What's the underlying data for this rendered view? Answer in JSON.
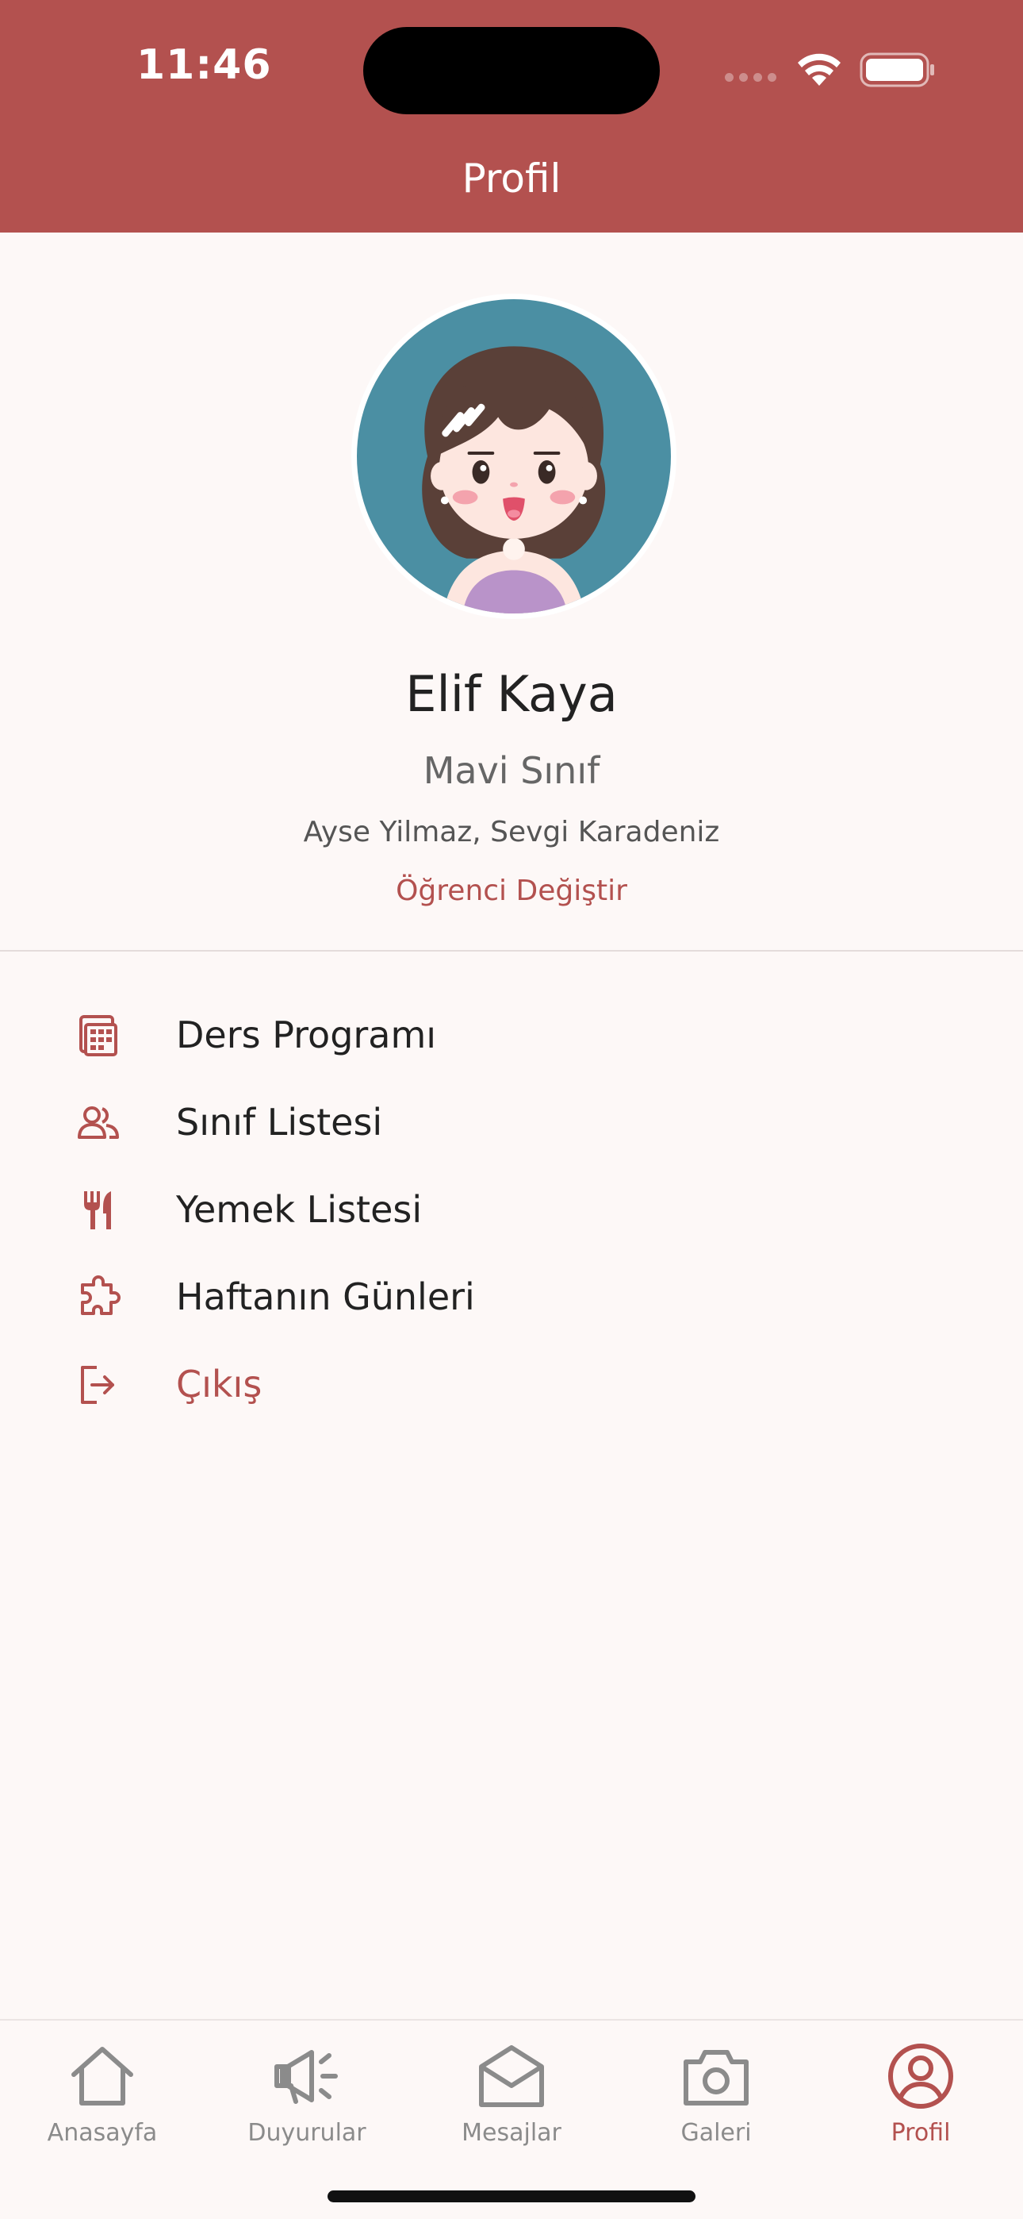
{
  "status_bar": {
    "time": "11:46"
  },
  "header": {
    "title": "Profil"
  },
  "profile": {
    "name": "Elif Kaya",
    "class_name": "Mavi Sınıf",
    "teachers": "Ayse Yilmaz, Sevgi Karadeniz",
    "change_student_label": "Öğrenci Değiştir"
  },
  "menu": {
    "items": [
      {
        "label": "Ders Programı",
        "icon": "calendar-grid-icon"
      },
      {
        "label": "Sınıf Listesi",
        "icon": "people-icon"
      },
      {
        "label": "Yemek Listesi",
        "icon": "fork-knife-icon"
      },
      {
        "label": "Haftanın Günleri",
        "icon": "puzzle-icon"
      },
      {
        "label": "Çıkış",
        "icon": "logout-icon"
      }
    ]
  },
  "tabbar": {
    "tabs": [
      {
        "label": "Anasayfa",
        "icon": "home-icon"
      },
      {
        "label": "Duyurular",
        "icon": "megaphone-icon"
      },
      {
        "label": "Mesajlar",
        "icon": "envelope-icon"
      },
      {
        "label": "Galeri",
        "icon": "camera-icon"
      },
      {
        "label": "Profil",
        "icon": "user-circle-icon"
      }
    ],
    "active": "Profil"
  },
  "colors": {
    "accent": "#b3514f",
    "background": "#fdf8f7",
    "text_dark": "#222222",
    "text_muted": "#8b8b8b"
  }
}
